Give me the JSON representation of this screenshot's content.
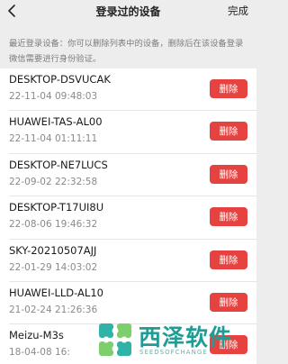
{
  "navbar": {
    "title": "登录过的设备",
    "done_label": "完成"
  },
  "hint": {
    "text": "最近登录设备：你可以删除列表中的设备，删除后在该设备登录微信需要进行身份验证。"
  },
  "devices": [
    {
      "name": "DESKTOP-DSVUCAK",
      "time": "22-11-04 09:48:03",
      "delete_label": "删除"
    },
    {
      "name": "HUAWEI-TAS-AL00",
      "time": "22-11-04 01:11:11",
      "delete_label": "删除"
    },
    {
      "name": "DESKTOP-NE7LUCS",
      "time": "22-09-02 22:32:58",
      "delete_label": "删除"
    },
    {
      "name": "DESKTOP-T17UI8U",
      "time": "22-08-06 19:46:32",
      "delete_label": "删除"
    },
    {
      "name": "SKY-20210507AJJ",
      "time": "22-01-29 14:03:02",
      "delete_label": "删除"
    },
    {
      "name": "HUAWEI-LLD-AL10",
      "time": "21-02-24 21:26:36",
      "delete_label": "删除"
    },
    {
      "name": "Meizu-M3s",
      "time": "18-04-08 16:",
      "delete_label": "删除"
    }
  ],
  "watermark": {
    "brand": "西泽软件",
    "sub": "SEEDSOFCHANGE"
  },
  "colors": {
    "background": "#ededed",
    "delete_button": "#e64340",
    "watermark": "#1f9d95"
  },
  "icons": {
    "back": "chevron-left-icon"
  }
}
